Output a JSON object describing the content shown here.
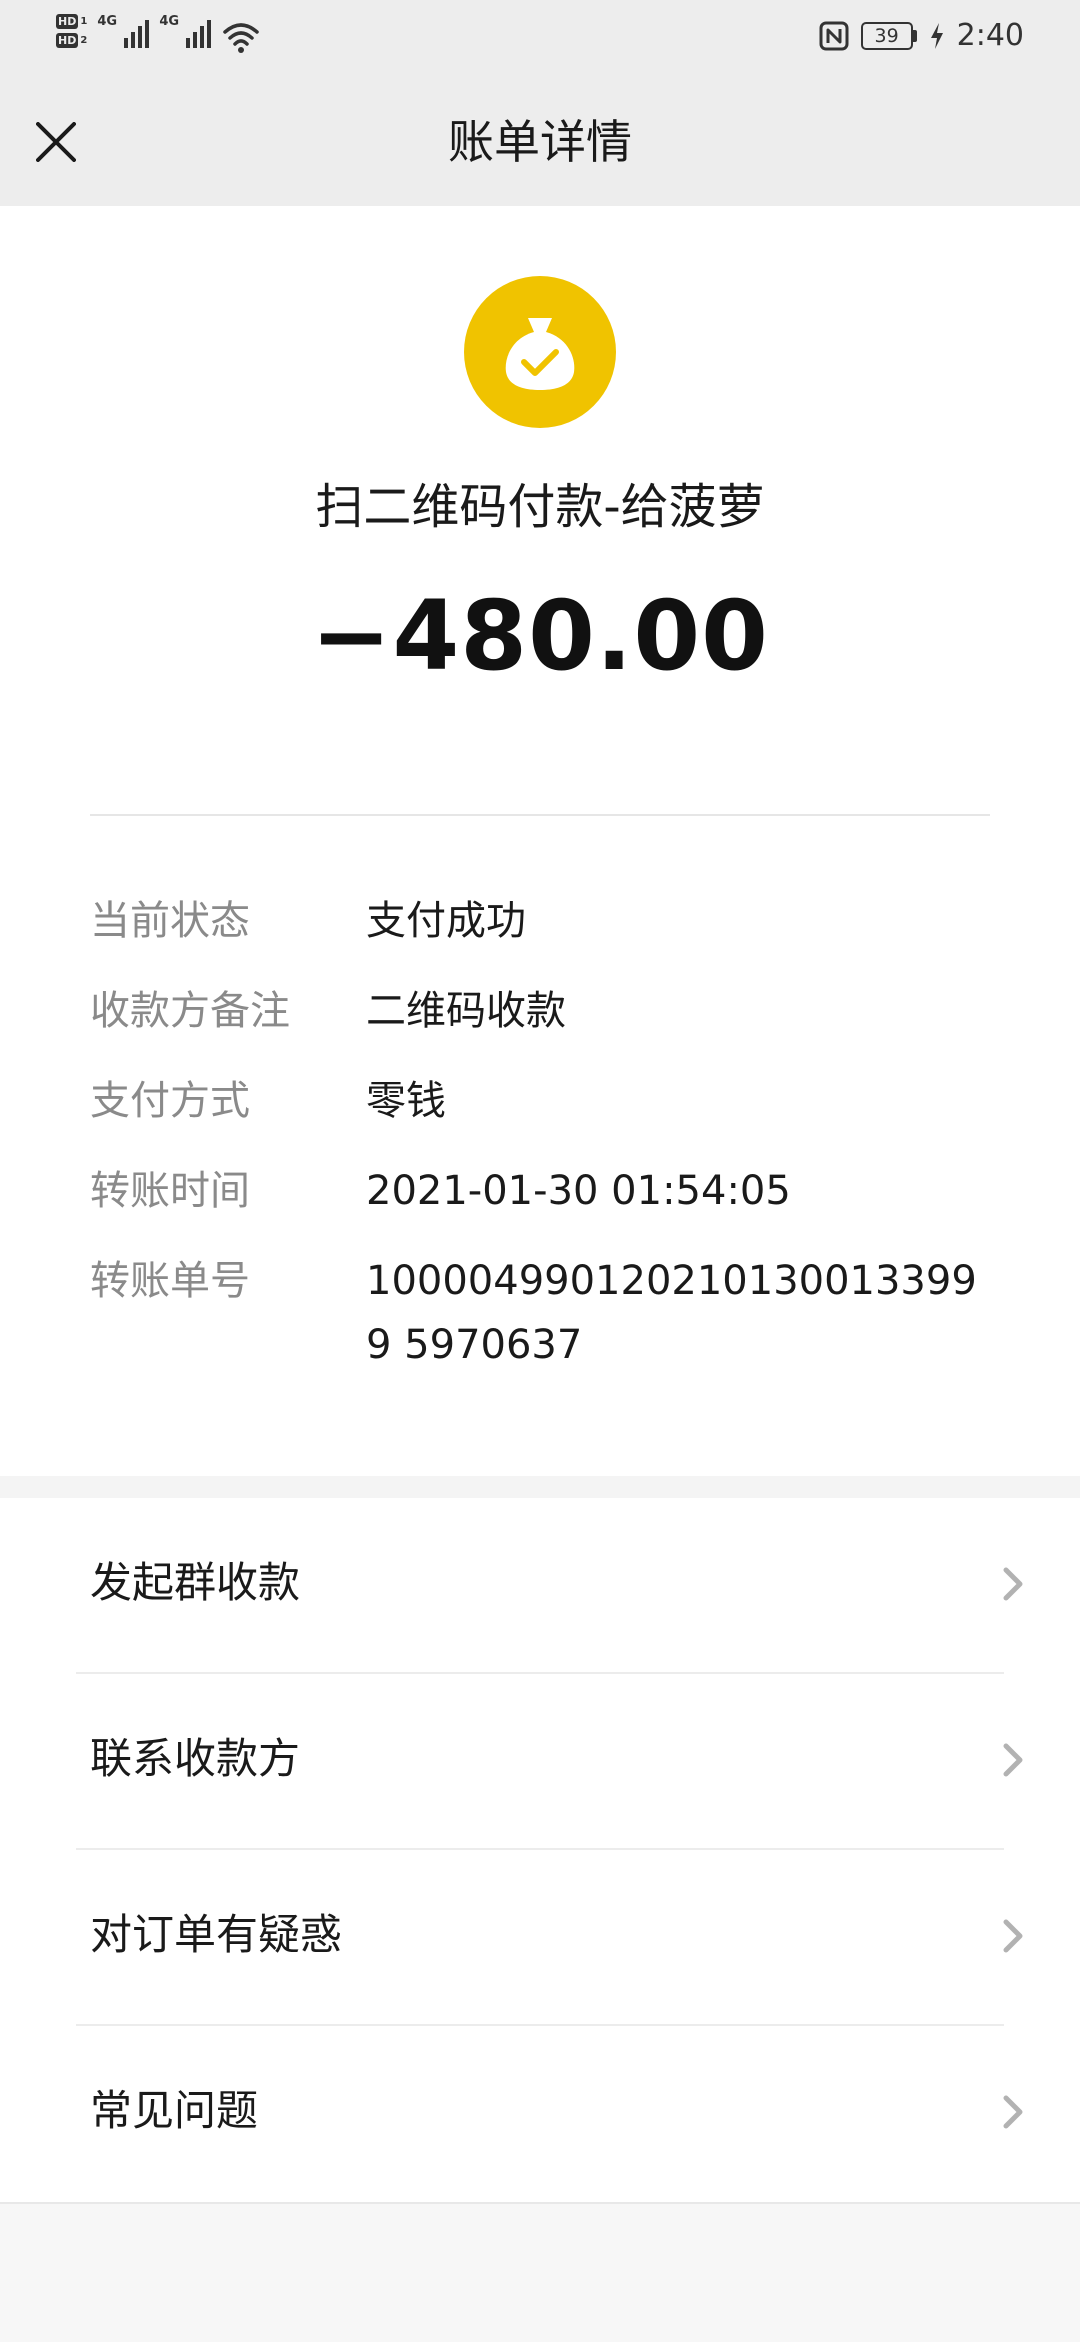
{
  "status_bar": {
    "hd1": "HD",
    "hd1_sub": "1",
    "hd2": "HD",
    "hd2_sub": "2",
    "net1": "4G",
    "net2": "4G",
    "battery": "39",
    "time": "2:40",
    "icons": [
      "hd-icon",
      "signal-icon",
      "wifi-icon",
      "nfc-icon",
      "battery-icon",
      "charging-icon"
    ]
  },
  "header": {
    "title": "账单详情",
    "close_icon": "close-icon"
  },
  "transaction": {
    "icon": "money-bag-check-icon",
    "icon_color": "#F0C300",
    "title": "扫二维码付款-给菠萝",
    "amount": "−480.00"
  },
  "details": [
    {
      "label": "当前状态",
      "value": "支付成功"
    },
    {
      "label": "收款方备注",
      "value": "二维码收款"
    },
    {
      "label": "支付方式",
      "value": "零钱"
    },
    {
      "label": "转账时间",
      "value": "2021-01-30 01:54:05"
    },
    {
      "label": "转账单号",
      "value": "1000049901202101300133999 5970637"
    }
  ],
  "actions": [
    {
      "label": "发起群收款"
    },
    {
      "label": "联系收款方"
    },
    {
      "label": "对订单有疑惑"
    },
    {
      "label": "常见问题"
    }
  ]
}
